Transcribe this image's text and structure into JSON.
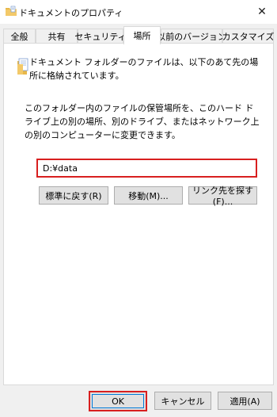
{
  "window": {
    "title": "ドキュメントのプロパティ",
    "close_glyph": "✕"
  },
  "tabs": [
    {
      "label": "全般"
    },
    {
      "label": "共有"
    },
    {
      "label": "セキュリティ"
    },
    {
      "label": "場所",
      "active": true
    },
    {
      "label": "以前のバージョン"
    },
    {
      "label": "カスタマイズ"
    }
  ],
  "location": {
    "description": "ドキュメント フォルダーのファイルは、以下のあて先の場所に格納されています。",
    "instruction": "このフォルダー内のファイルの保管場所を、このハード ドライブ上の別の場所、別のドライブ、またはネットワーク上の別のコンピューターに変更できます。",
    "path_value": "D:¥data",
    "restore_default_label": "標準に戻す(R)",
    "move_label": "移動(M)...",
    "find_target_label": "リンク先を探す(F)..."
  },
  "footer": {
    "ok_label": "OK",
    "cancel_label": "キャンセル",
    "apply_label": "適用(A)"
  },
  "colors": {
    "highlight": "#d81f1f",
    "folder": "#e8b84a",
    "focus": "#0078d7"
  },
  "icons": {
    "title": "folder-document-icon",
    "panel": "folder-icon",
    "close": "close-icon"
  }
}
